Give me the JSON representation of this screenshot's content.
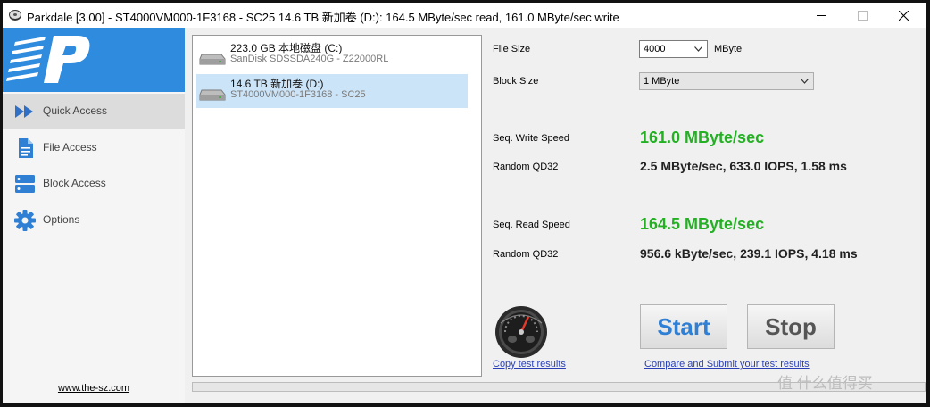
{
  "window": {
    "title": "Parkdale [3.00] - ST4000VM000-1F3168 - SC25 14.6 TB 新加卷 (D:): 164.5 MByte/sec read, 161.0 MByte/sec write",
    "controls": [
      "minimize-icon",
      "maximize-icon",
      "close-icon"
    ]
  },
  "sidebar": {
    "items": [
      {
        "label": "Quick Access",
        "icon": "fast-forward-icon",
        "active": true
      },
      {
        "label": "File Access",
        "icon": "file-icon",
        "active": false
      },
      {
        "label": "Block Access",
        "icon": "blocks-icon",
        "active": false
      },
      {
        "label": "Options",
        "icon": "gear-icon",
        "active": false
      }
    ],
    "website": "www.the-sz.com"
  },
  "drives": [
    {
      "name": "223.0 GB 本地磁盘 (C:)",
      "model": "SanDisk SDSSDA240G - Z22000RL",
      "selected": false
    },
    {
      "name": "14.6 TB 新加卷 (D:)",
      "model": "ST4000VM000-1F3168 - SC25",
      "selected": true
    }
  ],
  "settings": {
    "file_size_label": "File Size",
    "file_size_value": "4000",
    "file_size_unit": "MByte",
    "block_size_label": "Block Size",
    "block_size_value": "1 MByte"
  },
  "results": {
    "seq_write_label": "Seq. Write Speed",
    "seq_write_value": "161.0 MByte/sec",
    "random_write_label": "Random QD32",
    "random_write_value": "2.5 MByte/sec, 633.0 IOPS, 1.58 ms",
    "seq_read_label": "Seq. Read Speed",
    "seq_read_value": "164.5 MByte/sec",
    "random_read_label": "Random QD32",
    "random_read_value": "956.6 kByte/sec, 239.1 IOPS, 4.18 ms"
  },
  "actions": {
    "copy_label": "Copy test results",
    "compare_label": "Compare and Submit your test results",
    "start_label": "Start",
    "stop_label": "Stop"
  },
  "progress": 0,
  "watermark": "值 什么值得买",
  "colors": {
    "accent": "#2f8bdd",
    "speed_green": "#23b023",
    "start_text": "#2f7fd4",
    "stop_text": "#555555",
    "selection": "#cce4f7"
  }
}
